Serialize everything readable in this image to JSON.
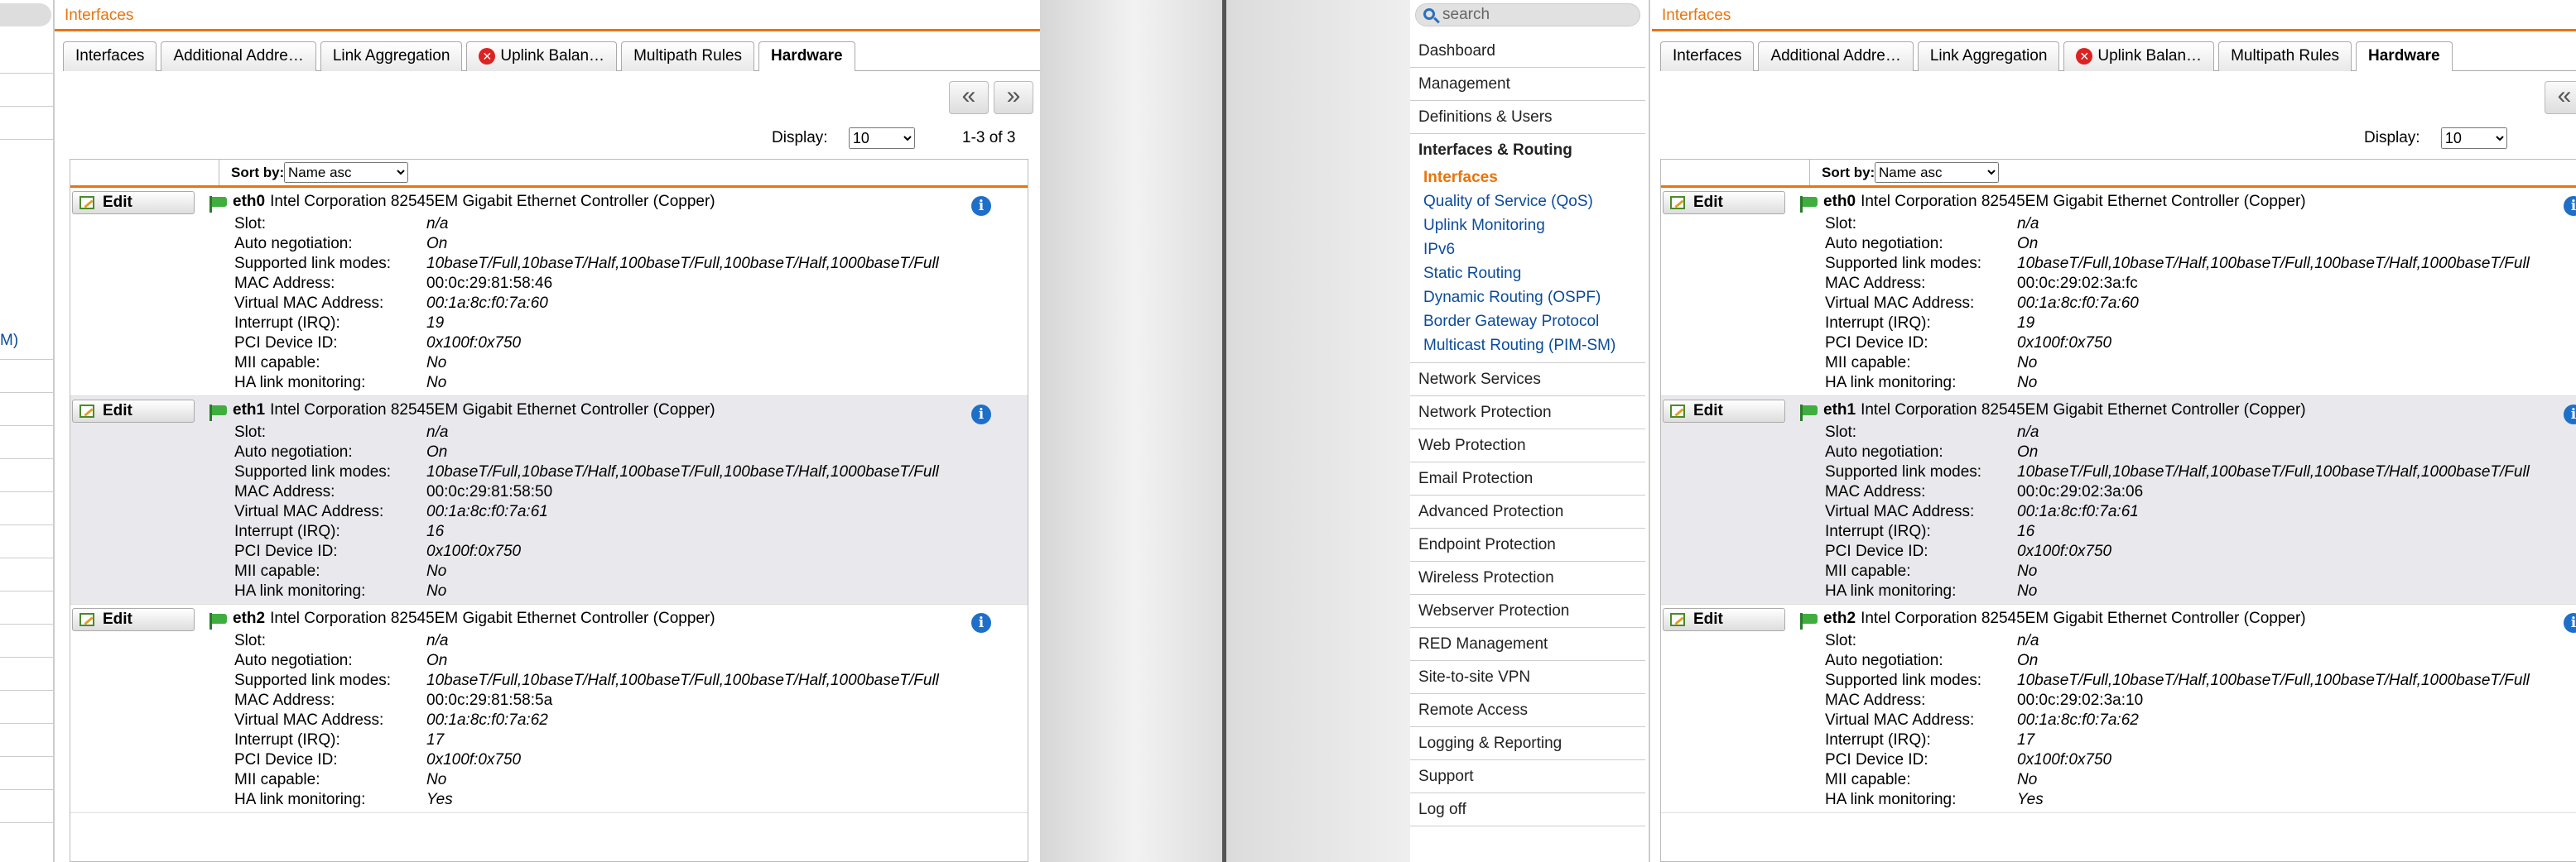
{
  "left_window": {
    "breadcrumb": "Interfaces",
    "sidebar_fragment": "M)",
    "display_label": "Display:",
    "display_value": "10",
    "result_count": "1-3 of 3"
  },
  "right_window": {
    "search_placeholder": "search",
    "breadcrumb": "Interfaces",
    "display_label": "Display:",
    "display_value": "10",
    "nav": {
      "items_top": [
        "Dashboard",
        "Management",
        "Definitions & Users"
      ],
      "section": "Interfaces & Routing",
      "subitems": [
        "Interfaces",
        "Quality of Service (QoS)",
        "Uplink Monitoring",
        "IPv6",
        "Static Routing",
        "Dynamic Routing (OSPF)",
        "Border Gateway Protocol",
        "Multicast Routing (PIM-SM)"
      ],
      "items_bottom": [
        "Network Services",
        "Network Protection",
        "Web Protection",
        "Email Protection",
        "Advanced Protection",
        "Endpoint Protection",
        "Wireless Protection",
        "Webserver Protection",
        "RED Management",
        "Site-to-site VPN",
        "Remote Access",
        "Logging & Reporting",
        "Support",
        "Log off"
      ]
    }
  },
  "tabs": [
    "Interfaces",
    "Additional Addre…",
    "Link Aggregation",
    "Uplink Balan…",
    "Multipath Rules",
    "Hardware"
  ],
  "active_tab": "Hardware",
  "pager": {
    "first": "«",
    "last": "»"
  },
  "sort_label": "Sort by:",
  "sort_value": "Name asc",
  "edit_label": "Edit",
  "info_glyph": "i",
  "prop_labels": [
    "Slot:",
    "Auto negotiation:",
    "Supported link modes:",
    "MAC Address:",
    "Virtual MAC Address:",
    "Interrupt (IRQ):",
    "PCI Device ID:",
    "MII capable:",
    "HA link monitoring:"
  ],
  "devices_left": [
    {
      "name": "eth0",
      "desc": "Intel Corporation 82545EM Gigabit Ethernet Controller (Copper)",
      "slot": "n/a",
      "autoneg": "On",
      "modes": "10baseT/Full,10baseT/Half,100baseT/Full,100baseT/Half,1000baseT/Full",
      "mac": "00:0c:29:81:58:46",
      "vmac": "00:1a:8c:f0:7a:60",
      "irq": "19",
      "pci": "0x100f:0x750",
      "mii": "No",
      "ha": "No"
    },
    {
      "name": "eth1",
      "desc": "Intel Corporation 82545EM Gigabit Ethernet Controller (Copper)",
      "slot": "n/a",
      "autoneg": "On",
      "modes": "10baseT/Full,10baseT/Half,100baseT/Full,100baseT/Half,1000baseT/Full",
      "mac": "00:0c:29:81:58:50",
      "vmac": "00:1a:8c:f0:7a:61",
      "irq": "16",
      "pci": "0x100f:0x750",
      "mii": "No",
      "ha": "No"
    },
    {
      "name": "eth2",
      "desc": "Intel Corporation 82545EM Gigabit Ethernet Controller (Copper)",
      "slot": "n/a",
      "autoneg": "On",
      "modes": "10baseT/Full,10baseT/Half,100baseT/Full,100baseT/Half,1000baseT/Full",
      "mac": "00:0c:29:81:58:5a",
      "vmac": "00:1a:8c:f0:7a:62",
      "irq": "17",
      "pci": "0x100f:0x750",
      "mii": "No",
      "ha": "Yes"
    }
  ],
  "devices_right": [
    {
      "name": "eth0",
      "desc": "Intel Corporation 82545EM Gigabit Ethernet Controller (Copper)",
      "slot": "n/a",
      "autoneg": "On",
      "modes": "10baseT/Full,10baseT/Half,100baseT/Full,100baseT/Half,1000baseT/Full",
      "mac": "00:0c:29:02:3a:fc",
      "vmac": "00:1a:8c:f0:7a:60",
      "irq": "19",
      "pci": "0x100f:0x750",
      "mii": "No",
      "ha": "No"
    },
    {
      "name": "eth1",
      "desc": "Intel Corporation 82545EM Gigabit Ethernet Controller (Copper)",
      "slot": "n/a",
      "autoneg": "On",
      "modes": "10baseT/Full,10baseT/Half,100baseT/Full,100baseT/Half,1000baseT/Full",
      "mac": "00:0c:29:02:3a:06",
      "vmac": "00:1a:8c:f0:7a:61",
      "irq": "16",
      "pci": "0x100f:0x750",
      "mii": "No",
      "ha": "No"
    },
    {
      "name": "eth2",
      "desc": "Intel Corporation 82545EM Gigabit Ethernet Controller (Copper)",
      "slot": "n/a",
      "autoneg": "On",
      "modes": "10baseT/Full,10baseT/Half,100baseT/Full,100baseT/Half,1000baseT/Full",
      "mac": "00:0c:29:02:3a:10",
      "vmac": "00:1a:8c:f0:7a:62",
      "irq": "17",
      "pci": "0x100f:0x750",
      "mii": "No",
      "ha": "Yes"
    }
  ],
  "colors": {
    "accent": "#e8740c",
    "link": "#0a4b9a",
    "info": "#1e6fc8",
    "error": "#dd2222",
    "alt_row": "#e9e9ed"
  }
}
